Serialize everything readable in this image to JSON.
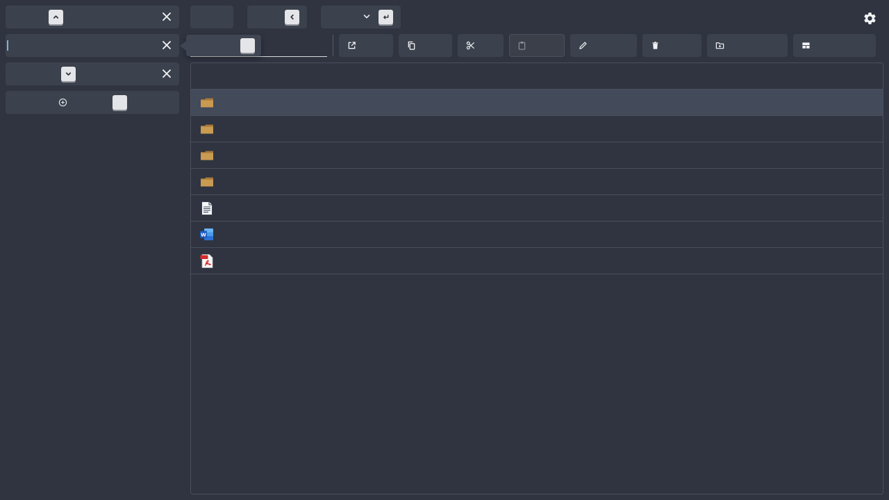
{
  "sidebar": {
    "tabs": [
      {
        "keycap_icon": "chevron-up-icon",
        "close_icon": "close-icon"
      },
      {
        "keycap_icon": "",
        "close_icon": "close-icon"
      },
      {
        "keycap_icon": "chevron-down-icon",
        "close_icon": "close-icon"
      }
    ],
    "add_tab": {
      "icon": "plus-circle-icon"
    }
  },
  "top_bar": {
    "back_key_icon": "chevron-left-icon",
    "dropdown_icon": "chevron-down-icon",
    "enter_key_icon": "enter-icon",
    "settings_icon": "gear-icon"
  },
  "toolbar": {
    "path_value": "",
    "buttons": [
      {
        "name": "open",
        "icon": "external-link-icon",
        "label": ""
      },
      {
        "name": "copy",
        "icon": "copy-icon",
        "label": ""
      },
      {
        "name": "cut",
        "icon": "scissors-icon",
        "label": ""
      },
      {
        "name": "paste",
        "icon": "clipboard-icon",
        "label": "",
        "disabled": true
      },
      {
        "name": "rename",
        "icon": "pencil-icon",
        "label": ""
      },
      {
        "name": "delete",
        "icon": "trash-icon",
        "label": ""
      },
      {
        "name": "new-folder",
        "icon": "folder-plus-icon",
        "label": ""
      },
      {
        "name": "layout",
        "icon": "layout-icon",
        "label": ""
      }
    ]
  },
  "file_list": {
    "header": "",
    "rows": [
      {
        "type": "folder",
        "name": "",
        "selected": true
      },
      {
        "type": "folder",
        "name": ""
      },
      {
        "type": "folder",
        "name": ""
      },
      {
        "type": "folder",
        "name": ""
      },
      {
        "type": "text-document",
        "name": ""
      },
      {
        "type": "word-document",
        "name": ""
      },
      {
        "type": "pdf-document",
        "name": ""
      }
    ]
  },
  "colors": {
    "background": "#2f3440",
    "panel": "#3b414d",
    "selected_row": "#434a5a",
    "folder": "#c99a52",
    "word_blue": "#2b6fd6",
    "pdf_red": "#d42b2b"
  }
}
